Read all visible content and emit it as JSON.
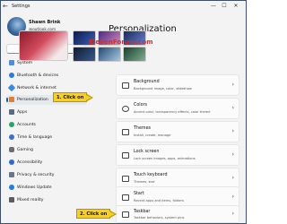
{
  "window": {
    "title": "Settings",
    "minimize": "—",
    "maximize": "☐",
    "close": "✕"
  },
  "user": {
    "name": "Shawn Brink",
    "email": "@outlook.com"
  },
  "search": {
    "placeholder": "",
    "icon": "search-icon"
  },
  "sidebar": {
    "items": [
      {
        "label": "System",
        "color": "#4a90e2"
      },
      {
        "label": "Bluetooth & devices",
        "color": "#2f7bd8"
      },
      {
        "label": "Network & internet",
        "color": "#3b88e0"
      },
      {
        "label": "Personalization",
        "color": "#e07f3b"
      },
      {
        "label": "Apps",
        "color": "#5a6b80"
      },
      {
        "label": "Accounts",
        "color": "#2aa36b"
      },
      {
        "label": "Time & language",
        "color": "#3d6fd0"
      },
      {
        "label": "Gaming",
        "color": "#6d6d6d"
      },
      {
        "label": "Accessibility",
        "color": "#2f6ad1"
      },
      {
        "label": "Privacy & security",
        "color": "#6e7686"
      },
      {
        "label": "Windows Update",
        "color": "#1f7de0"
      },
      {
        "label": "Mixed reality",
        "color": "#5c5c5c"
      }
    ],
    "active_index": 3
  },
  "main": {
    "title": "Personalization",
    "watermark": "ElevenForum.com",
    "cards": [
      {
        "title": "Background",
        "desc": "Background image, color, slideshow"
      },
      {
        "title": "Colors",
        "desc": "Accent color, transparency effects, color theme"
      },
      {
        "title": "Themes",
        "desc": "Install, create, manage"
      },
      {
        "title": "Lock screen",
        "desc": "Lock screen images, apps, animations"
      },
      {
        "title": "Touch keyboard",
        "desc": "Themes, size"
      },
      {
        "title": "Start",
        "desc": "Recent apps and items, folders"
      },
      {
        "title": "Taskbar",
        "desc": "Taskbar behaviors, system pins"
      }
    ]
  },
  "callouts": {
    "step1": "1. Click on",
    "step2": "2. Click on"
  },
  "colors": {
    "accent": "#0067c0",
    "callout": "#f4cf2e"
  }
}
